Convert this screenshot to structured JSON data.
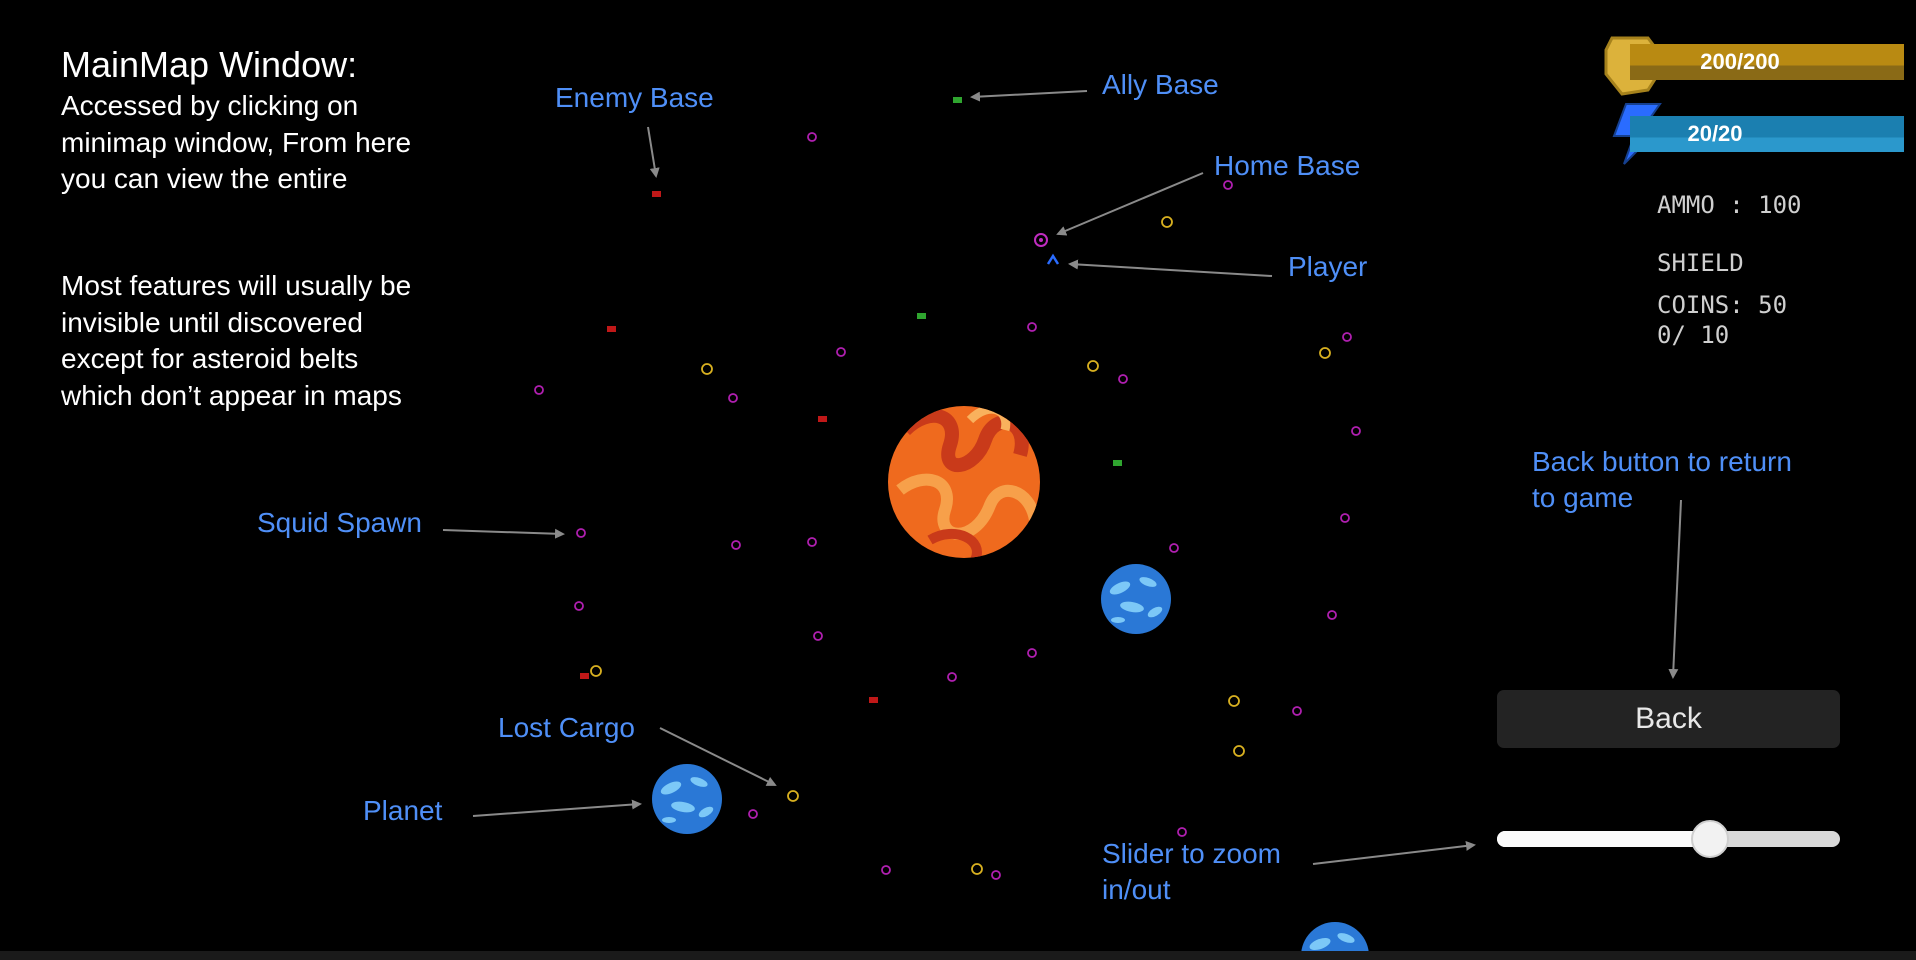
{
  "intro": {
    "title": "MainMap Window:",
    "description": "Accessed by clicking on\nminimap window, From here\nyou can view the entire",
    "note": "Most features will usually be\ninvisible until discovered\nexcept for asteroid belts\nwhich don’t appear in maps"
  },
  "annotations": {
    "enemy_base": "Enemy Base",
    "ally_base": "Ally Base",
    "home_base": "Home Base",
    "player": "Player",
    "squid_spawn": "Squid Spawn",
    "lost_cargo": "Lost Cargo",
    "planet": "Planet",
    "back_hint": "Back button to return\nto game",
    "slider_hint": "Slider to zoom\nin/out"
  },
  "hud": {
    "health": {
      "label": "200/200",
      "current": 200,
      "max": 200,
      "color": "#c9a12d",
      "icon": "shield-badge-icon"
    },
    "energy": {
      "label": "20/20",
      "current": 20,
      "max": 20,
      "color": "#1b7fb0",
      "icon": "lightning-icon"
    },
    "ammo": "AMMO : 100",
    "shield": "SHIELD",
    "coins": "COINS: 50",
    "progress": "0/ 10"
  },
  "back_button": {
    "label": "Back"
  },
  "zoom_slider": {
    "value": 0.62
  },
  "colors": {
    "annotation": "#4f8ff7",
    "squid_spawn": "#b01fb0",
    "lost_cargo": "#d8b020",
    "enemy_base": "#c01818",
    "ally_base": "#2fa52f",
    "player": "#2a6cff",
    "sun": "#ef6a1e",
    "planet": "#2a78d6"
  }
}
